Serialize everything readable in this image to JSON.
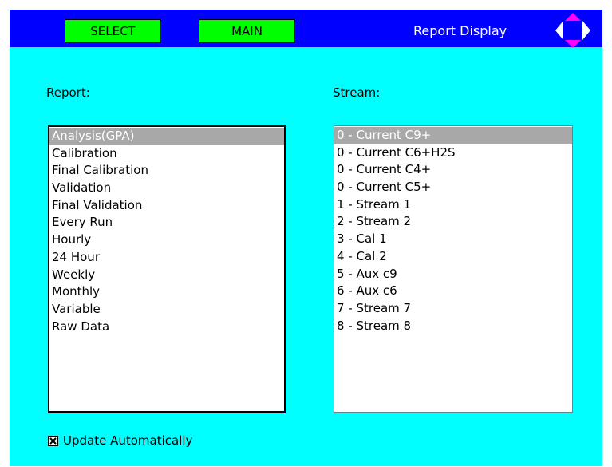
{
  "header": {
    "select_label": "SELECT",
    "main_label": "MAIN",
    "title": "Report Display",
    "nav_pad_icon": "direction-pad-icon"
  },
  "report": {
    "label": "Report:",
    "items": [
      "Analysis(GPA)",
      "Calibration",
      "Final Calibration",
      "Validation",
      "Final Validation",
      "Every Run",
      "Hourly",
      "24 Hour",
      "Weekly",
      "Monthly",
      "Variable",
      "Raw Data"
    ],
    "selected_index": 0
  },
  "stream": {
    "label": "Stream:",
    "items": [
      "0 - Current C9+",
      "0 - Current C6+H2S",
      "0 - Current C4+",
      "0 - Current C5+",
      "1 - Stream 1",
      "2 - Stream 2",
      "3 - Cal 1",
      "4 - Cal 2",
      "5 - Aux c9",
      "6 - Aux c6",
      "7 - Stream 7",
      "8 - Stream 8"
    ],
    "selected_index": 0
  },
  "auto_update": {
    "label": "Update Automatically",
    "checked": true
  },
  "colors": {
    "screen_bg": "#00ffff",
    "topbar_bg": "#0000ff",
    "button_bg": "#00ff00",
    "nav_arrow_magenta": "#ff00ff",
    "nav_arrow_white": "#ffffff",
    "selection_bg": "#a8a8a8"
  }
}
